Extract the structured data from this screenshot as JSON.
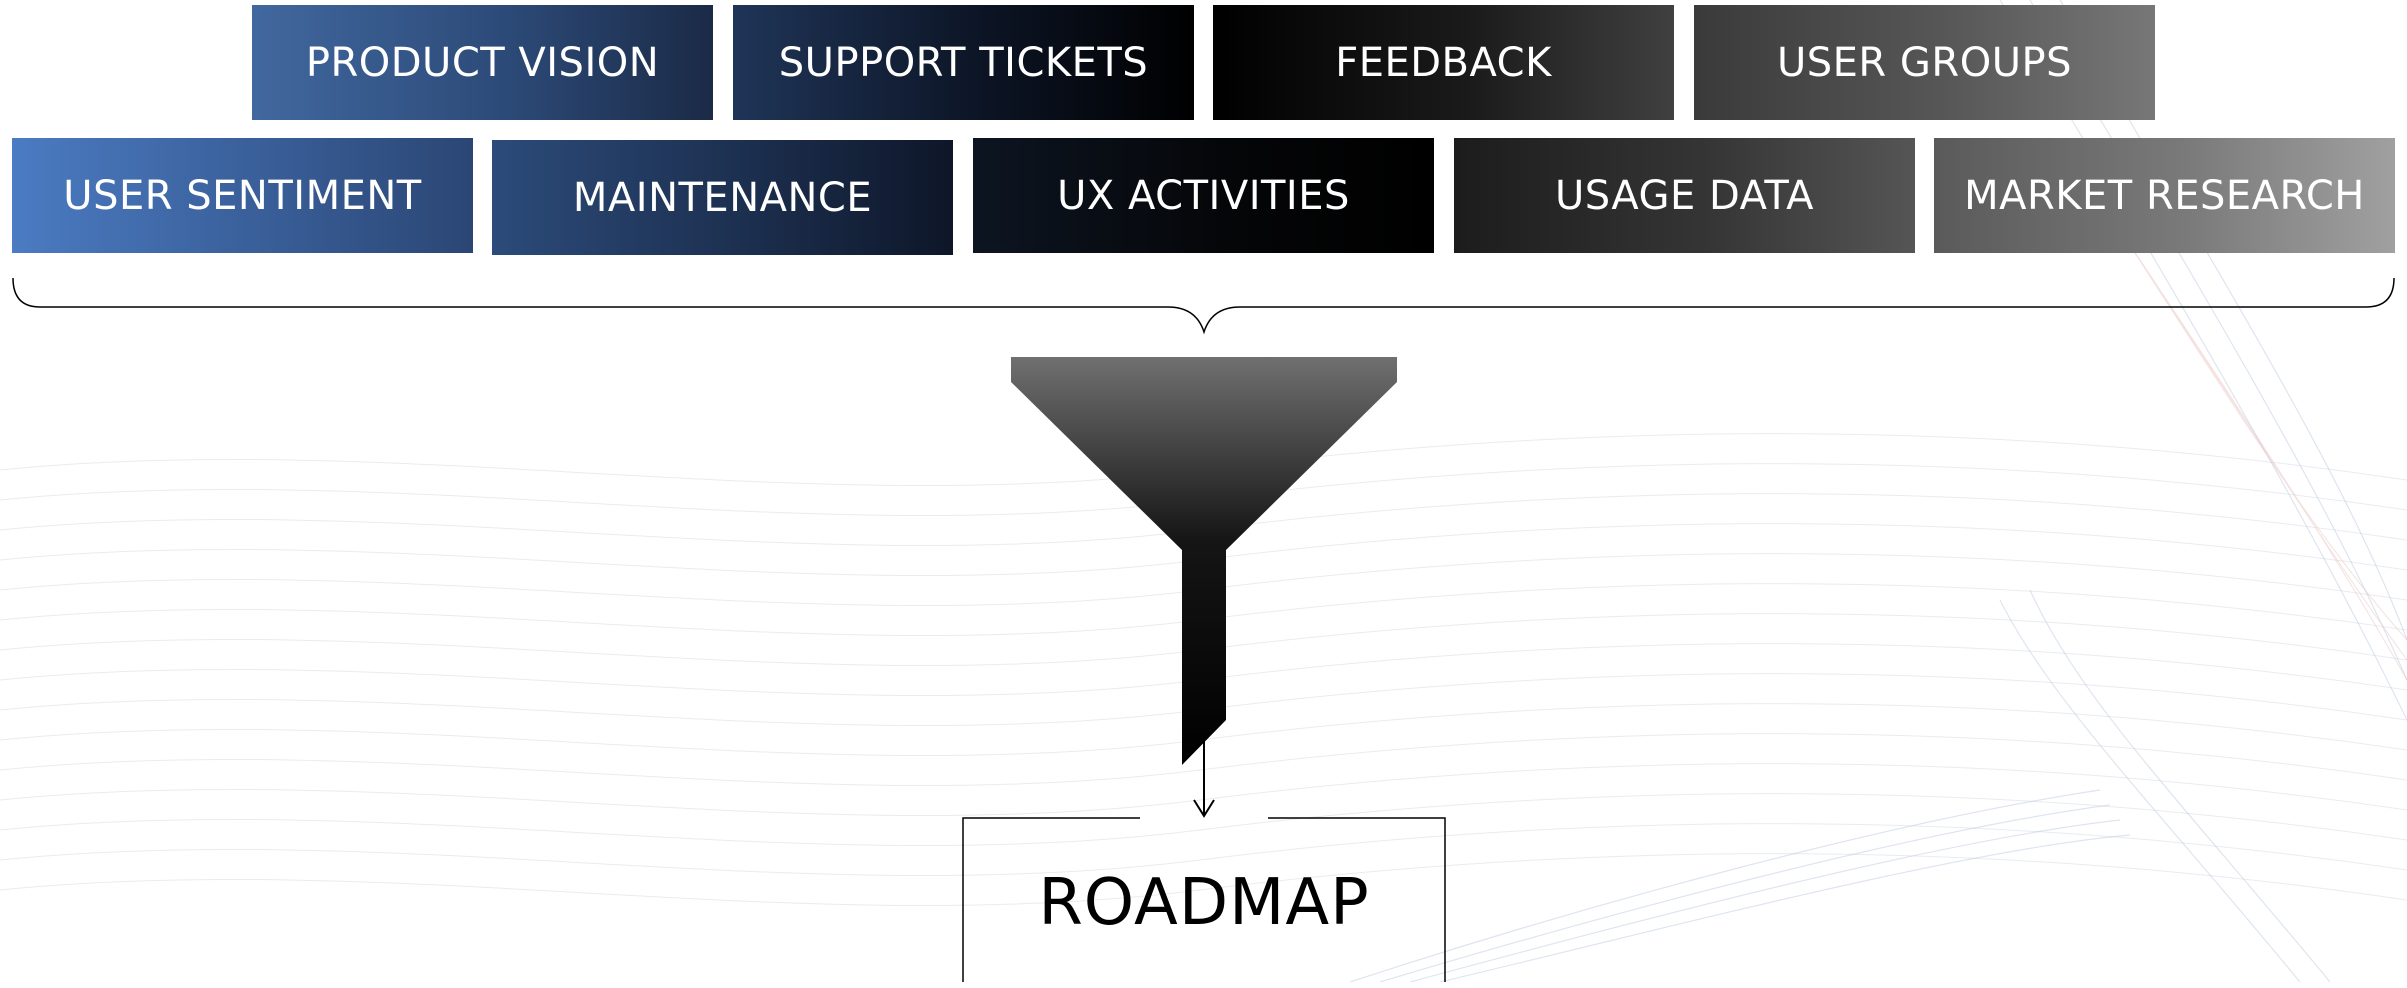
{
  "diagram": {
    "inputs_row1": [
      {
        "label": "PRODUCT VISION"
      },
      {
        "label": "SUPPORT TICKETS"
      },
      {
        "label": "FEEDBACK"
      },
      {
        "label": "USER GROUPS"
      }
    ],
    "inputs_row2": [
      {
        "label": "USER SENTIMENT"
      },
      {
        "label": "MAINTENANCE"
      },
      {
        "label": "UX ACTIVITIES"
      },
      {
        "label": "USAGE DATA"
      },
      {
        "label": "MARKET RESEARCH"
      }
    ],
    "output": {
      "label": "ROADMAP"
    }
  },
  "colors": {
    "box_text": "#ffffff",
    "connector": "#000000",
    "funnel_top": "#707070",
    "funnel_bottom": "#000000",
    "accent_blue": "#4b7bc2"
  },
  "icons": {
    "brace": "curly-brace-icon",
    "funnel": "funnel-icon",
    "arrow": "arrow-down-icon"
  }
}
